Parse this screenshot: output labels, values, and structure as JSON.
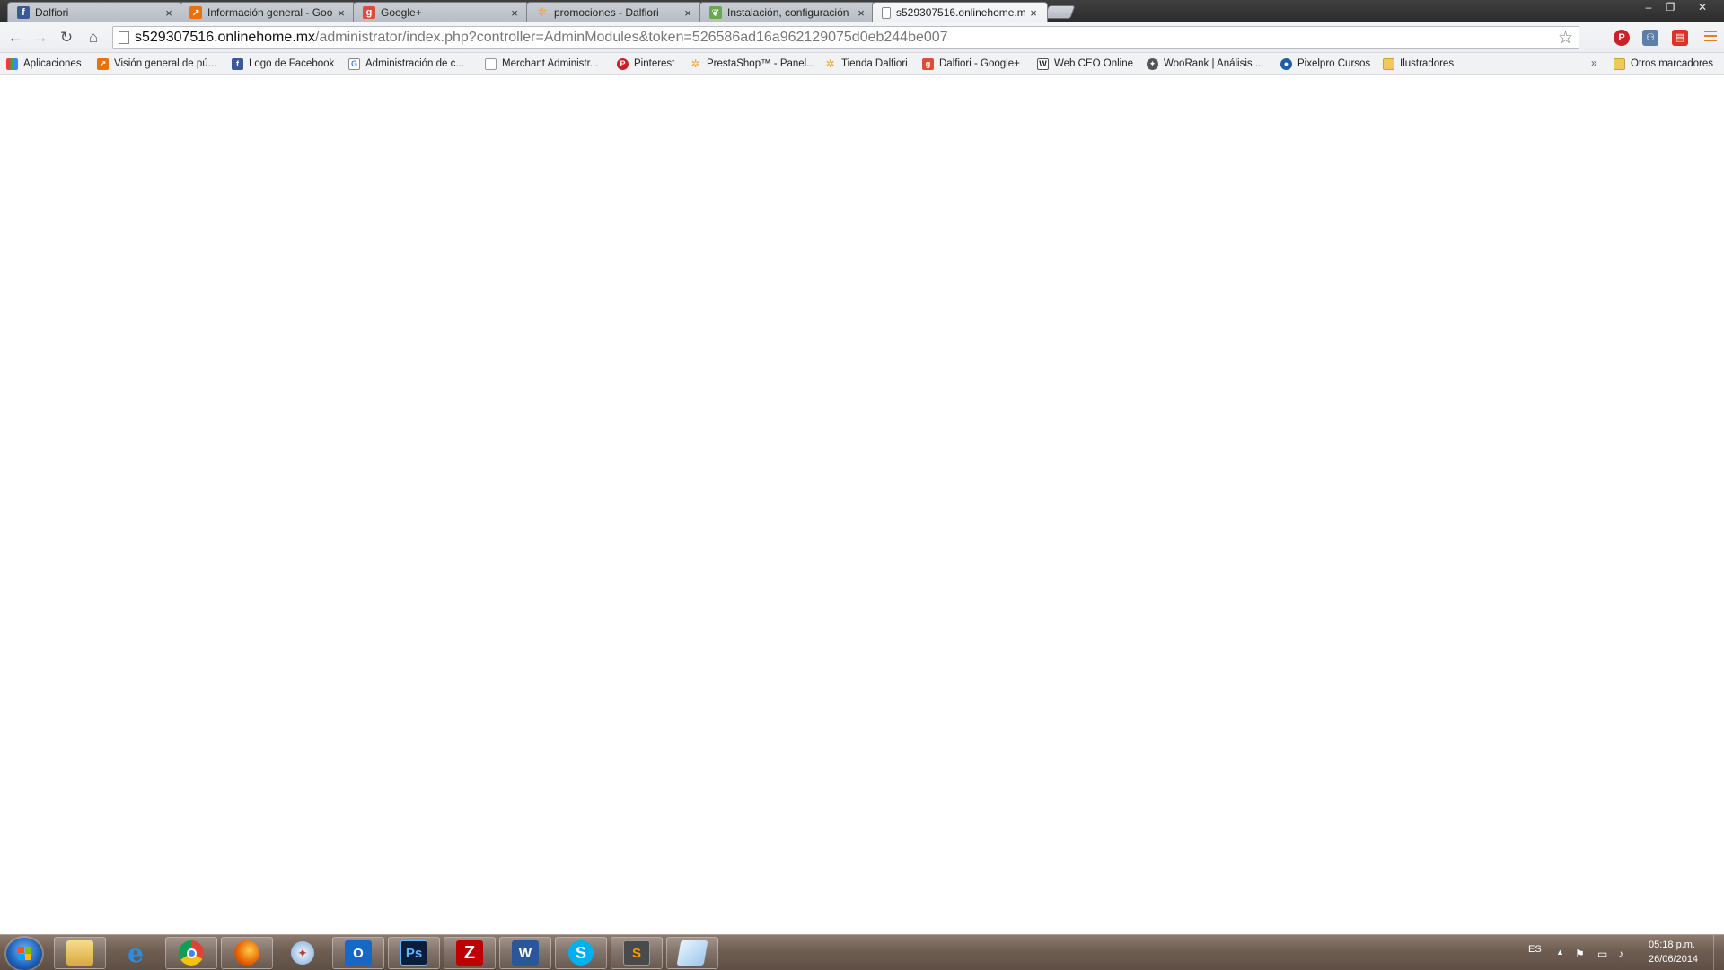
{
  "browser": {
    "tabs": [
      {
        "label": "Dalfiori",
        "icon": "facebook-icon",
        "state": "inactive"
      },
      {
        "label": "Información general - Goo",
        "icon": "analytics-icon",
        "state": "inactive"
      },
      {
        "label": "Google+",
        "icon": "google-plus-icon",
        "state": "inactive"
      },
      {
        "label": "promociones - Dalfiori",
        "icon": "prestashop-icon",
        "state": "inactive"
      },
      {
        "label": "Instalación, configuración",
        "icon": "leaf-icon",
        "state": "inactive"
      },
      {
        "label": "s529307516.onlinehome.m",
        "icon": "page-icon",
        "state": "active"
      }
    ],
    "tab_close_glyph": "×",
    "window_controls": {
      "minimize": "–",
      "restore": "❐",
      "close": "✕"
    },
    "url_host": "s529307516.onlinehome.mx",
    "url_path": "/administrator/index.php?controller=AdminModules&token=526586ad16a962129075d0eb244be007",
    "bookmarks": [
      {
        "label": "Aplicaciones",
        "icon": "apps-grid-icon"
      },
      {
        "label": "Visión general de pú...",
        "icon": "analytics-icon"
      },
      {
        "label": "Logo de Facebook",
        "icon": "facebook-icon"
      },
      {
        "label": "Administración de c...",
        "icon": "google-icon"
      },
      {
        "label": "Merchant Administr...",
        "icon": "page-icon"
      },
      {
        "label": "Pinterest",
        "icon": "pinterest-icon"
      },
      {
        "label": "PrestaShop™ - Panel...",
        "icon": "prestashop-icon"
      },
      {
        "label": "Tienda Dalfiori",
        "icon": "prestashop-icon"
      },
      {
        "label": "Dalfiori - Google+",
        "icon": "google-plus-icon"
      },
      {
        "label": "Web CEO Online",
        "icon": "webceo-icon"
      },
      {
        "label": "WooRank | Análisis ...",
        "icon": "woorank-icon"
      },
      {
        "label": "Pixelpro Cursos",
        "icon": "pixelpro-icon"
      },
      {
        "label": "Ilustradores",
        "icon": "folder-icon"
      }
    ],
    "other_bookmarks": "Otros marcadores",
    "bookmarks_overflow": "»"
  },
  "taskbar": {
    "apps": [
      {
        "name": "file-explorer",
        "icon": "folder-icon"
      },
      {
        "name": "internet-explorer",
        "icon": "ie-icon"
      },
      {
        "name": "chrome",
        "icon": "chrome-icon"
      },
      {
        "name": "firefox",
        "icon": "firefox-icon"
      },
      {
        "name": "safari",
        "icon": "compass-icon"
      },
      {
        "name": "outlook",
        "icon": "outlook-icon",
        "glyph": "O"
      },
      {
        "name": "photoshop",
        "icon": "photoshop-icon",
        "glyph": "Ps"
      },
      {
        "name": "filezilla",
        "icon": "filezilla-icon",
        "glyph": "Z"
      },
      {
        "name": "word",
        "icon": "word-icon",
        "glyph": "W"
      },
      {
        "name": "skype",
        "icon": "skype-icon",
        "glyph": "S"
      },
      {
        "name": "sublime-text",
        "icon": "sublime-icon",
        "glyph": "S"
      },
      {
        "name": "notes",
        "icon": "notes-icon"
      }
    ],
    "language": "ES",
    "time": "05:18 p.m.",
    "date": "26/06/2014"
  },
  "colors": {
    "facebook": "#3b5998",
    "google_plus": "#dd4b39",
    "pinterest": "#cb2027",
    "prestashop": "#f4a63a",
    "analytics": "#e8710a",
    "accent_menu": "#e67e22"
  }
}
